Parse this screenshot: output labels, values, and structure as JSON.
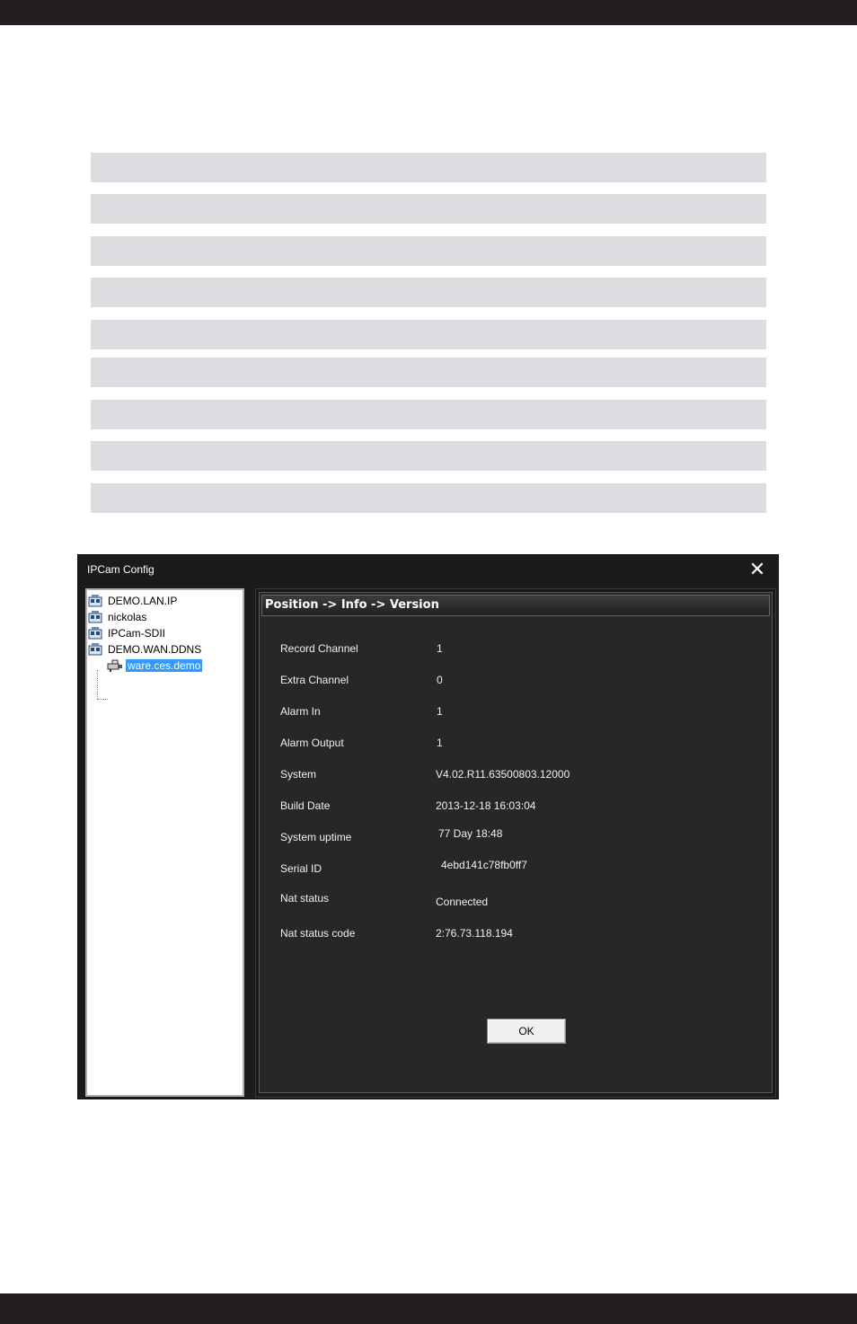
{
  "dialog": {
    "title": "IPCam Config",
    "close_glyph": "✕"
  },
  "tree": {
    "items": [
      {
        "label": "DEMO.LAN.IP",
        "icon": "device-group-icon"
      },
      {
        "label": "nickolas",
        "icon": "device-group-icon"
      },
      {
        "label": "IPCam-SDII",
        "icon": "device-group-icon"
      },
      {
        "label": "DEMO.WAN.DDNS",
        "icon": "device-group-icon"
      },
      {
        "label": "ware.ces.demo",
        "icon": "camera-device-icon",
        "selected": true
      }
    ]
  },
  "panel": {
    "header": "Position -> Info -> Version",
    "rows": [
      {
        "label": "Record Channel",
        "value": "1"
      },
      {
        "label": "Extra Channel",
        "value": "0"
      },
      {
        "label": "Alarm In",
        "value": "1"
      },
      {
        "label": "Alarm Output",
        "value": "1"
      },
      {
        "label": "System",
        "value": "V4.02.R11.63500803.12000"
      },
      {
        "label": "Build Date",
        "value": "2013-12-18 16:03:04"
      },
      {
        "label": "System uptime",
        "value": "77 Day 18:48"
      },
      {
        "label": "Serial ID",
        "value": "4ebd141c78fb0ff7"
      },
      {
        "label": "Nat status",
        "value": "Connected"
      },
      {
        "label": "Nat status code",
        "value": "2:76.73.118.194"
      }
    ],
    "ok_label": "OK"
  },
  "colors": {
    "top_bar": "#231f20",
    "gray_rows": "#dcdde0",
    "dialog_bg": "#1b1b1b",
    "selection": "#3399ff"
  }
}
